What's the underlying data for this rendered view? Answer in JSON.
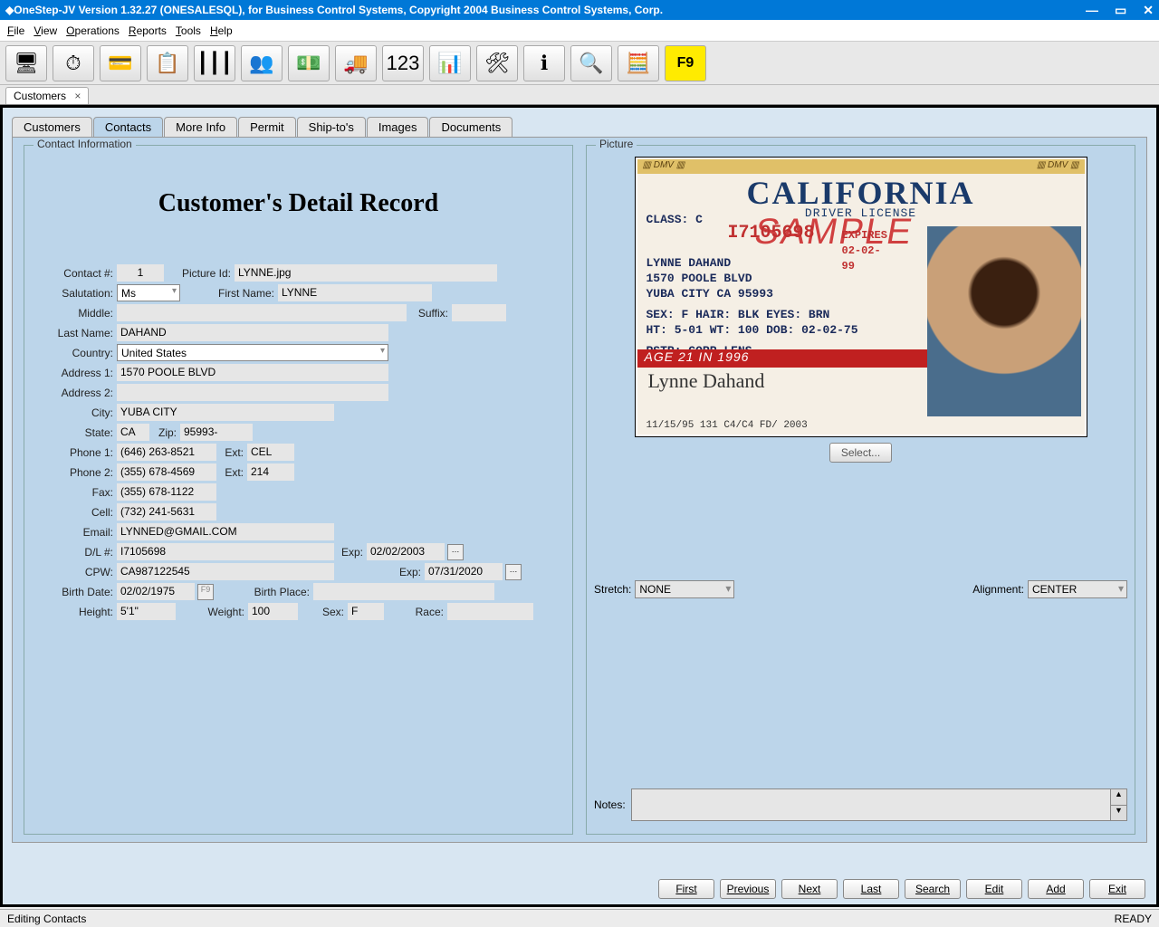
{
  "window": {
    "title": "OneStep-JV Version 1.32.27 (ONESALESQL), for Business Control Systems, Copyright  2004 Business Control Systems, Corp."
  },
  "menu": [
    "File",
    "View",
    "Operations",
    "Reports",
    "Tools",
    "Help"
  ],
  "toolbar_icons": [
    "🖥",
    "⏱",
    "💳",
    "📋",
    "┃┃┃",
    "👥",
    "💵",
    "🚚",
    "123",
    "📊",
    "🛠",
    "ℹ",
    "🔍",
    "🧮"
  ],
  "f9_label": "F9",
  "outer_tab": {
    "label": "Customers"
  },
  "tabs": [
    "Customers",
    "Contacts",
    "More Info",
    "Permit",
    "Ship-to's",
    "Images",
    "Documents"
  ],
  "active_tab": "Contacts",
  "fieldset_left": "Contact Information",
  "fieldset_right": "Picture",
  "headline": "Customer's Detail Record",
  "labels": {
    "contact_no": "Contact #:",
    "picture_id": "Picture Id:",
    "salutation": "Salutation:",
    "first_name": "First Name:",
    "middle": "Middle:",
    "suffix": "Suffix:",
    "last_name": "Last Name:",
    "country": "Country:",
    "address1": "Address 1:",
    "address2": "Address 2:",
    "city": "City:",
    "state": "State:",
    "zip": "Zip:",
    "phone1": "Phone 1:",
    "ext": "Ext:",
    "phone2": "Phone 2:",
    "fax": "Fax:",
    "cell": "Cell:",
    "email": "Email:",
    "dl": "D/L #:",
    "exp": "Exp:",
    "cpw": "CPW:",
    "birth_date": "Birth Date:",
    "birth_place": "Birth Place:",
    "height": "Height:",
    "weight": "Weight:",
    "sex": "Sex:",
    "race": "Race:",
    "stretch": "Stretch:",
    "alignment": "Alignment:",
    "notes": "Notes:"
  },
  "contact": {
    "contact_no": "1",
    "picture_id": "LYNNE.jpg",
    "salutation": "Ms",
    "first_name": "LYNNE",
    "middle": "",
    "suffix": "",
    "last_name": "DAHAND",
    "country": "United States",
    "address1": "1570 POOLE BLVD",
    "address2": "",
    "city": "YUBA CITY",
    "state": "CA",
    "zip": "95993-",
    "phone1": "(646) 263-8521",
    "phone1_ext": "CEL",
    "phone2": "(355) 678-4569",
    "phone2_ext": "214",
    "fax": "(355) 678-1122",
    "cell": "(732) 241-5631",
    "email": "LYNNED@GMAIL.COM",
    "dl": "I7105698",
    "dl_exp": "02/02/2003",
    "cpw": "CA987122545",
    "cpw_exp": "07/31/2020",
    "birth_date": "02/02/1975",
    "birth_place": "",
    "birth_f9": "F9",
    "height": "5'1\"",
    "weight": "100",
    "sex": "F",
    "race": ""
  },
  "picture": {
    "select": "Select...",
    "stretch": "NONE",
    "alignment": "CENTER"
  },
  "license": {
    "state": "CALIFORNIA",
    "doc": "DRIVER LICENSE",
    "class": "CLASS: C",
    "number": "I7105698",
    "expires": "EXPIRES 02-02-99",
    "sample": "SAMPLE",
    "name": "LYNNE DAHAND",
    "addr1": "1570 POOLE BLVD",
    "addr2": "YUBA CITY CA 95993",
    "sex": "SEX: F  HAIR: BLK   EYES: BRN",
    "ht": "HT: 5-01 WT: 100   DOB: 02-02-75",
    "rstr": "RSTR: CORR LENS",
    "agebar": "AGE 21 IN 1996",
    "sig": "Lynne Dahand",
    "footer": "11/15/95 131 C4/C4 FD/       2003"
  },
  "nav": [
    "First",
    "Previous",
    "Next",
    "Last",
    "Search",
    "Edit",
    "Add",
    "Exit"
  ],
  "status": {
    "left": "Editing Contacts",
    "right": "READY"
  }
}
